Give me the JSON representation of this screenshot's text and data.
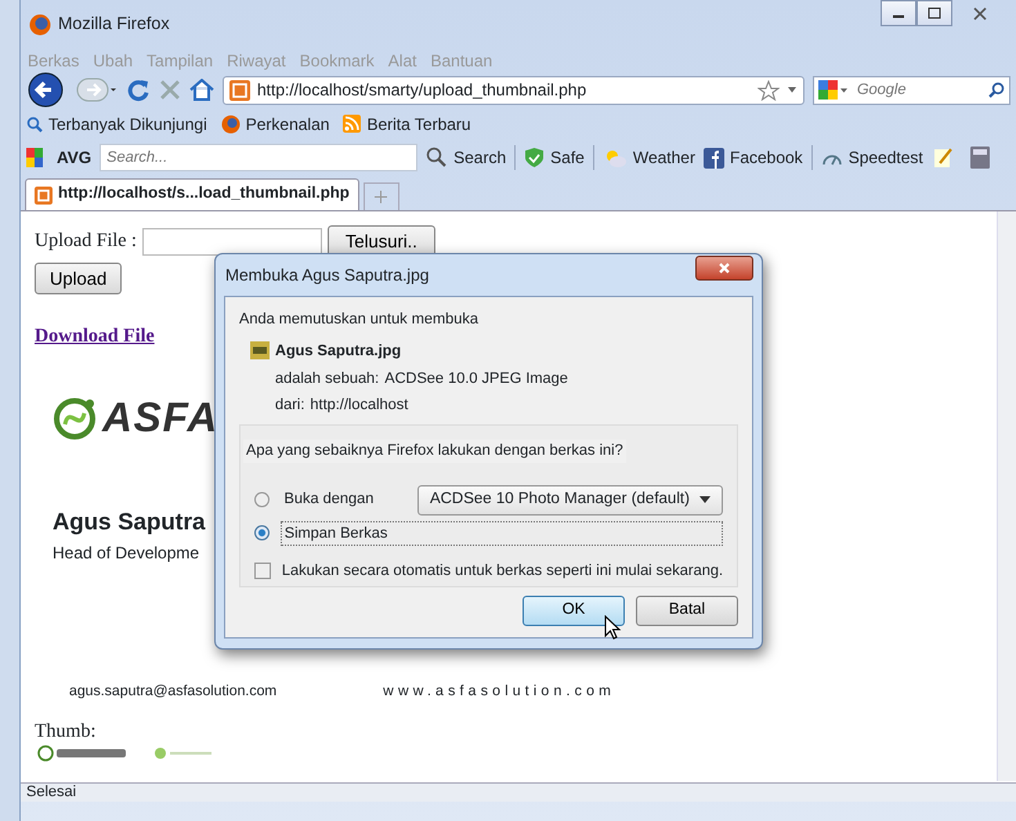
{
  "window": {
    "title": "Mozilla Firefox"
  },
  "menu": [
    "Berkas",
    "Ubah",
    "Tampilan",
    "Riwayat",
    "Bookmark",
    "Alat",
    "Bantuan"
  ],
  "address": {
    "value": "http://localhost/smarty/upload_thumbnail.php"
  },
  "web_search": {
    "placeholder": "Google"
  },
  "bookmarks": [
    "Terbanyak Dikunjungi",
    "Perkenalan",
    "Berita Terbaru"
  ],
  "avg_toolbar": {
    "brand": "AVG",
    "search_placeholder": "Search...",
    "items": [
      "Search",
      "Safe",
      "Weather",
      "Facebook",
      "Speedtest"
    ]
  },
  "tabs": [
    {
      "label": "http://localhost/s...load_thumbnail.php",
      "selected": true
    }
  ],
  "page": {
    "upload_label": "Upload File :",
    "browse_button": "Telusuri..",
    "upload_button": "Upload",
    "download_link": "Download File",
    "card": {
      "logo": "ASFA",
      "name": "Agus Saputra",
      "title": "Head of Developme",
      "email": "agus.saputra@asfasolution.com",
      "website": "www.asfasolution.com"
    },
    "thumb_label": "Thumb:"
  },
  "dialog": {
    "title": "Membuka Agus Saputra.jpg",
    "intro": "Anda memutuskan untuk membuka",
    "file_name": "Agus Saputra.jpg",
    "type_label": "adalah sebuah:",
    "type_value": "ACDSee 10.0 JPEG Image",
    "from_label": "dari:",
    "from_value": "http://localhost",
    "question": "Apa yang sebaiknya Firefox lakukan dengan berkas ini?",
    "options": [
      {
        "label": "Buka dengan",
        "selected": false
      },
      {
        "label": "Simpan Berkas",
        "selected": true
      }
    ],
    "app_select": "ACDSee 10 Photo Manager (default)",
    "auto_checkbox": {
      "label": "Lakukan secara otomatis untuk berkas seperti ini mulai sekarang.",
      "checked": false
    },
    "buttons": [
      "OK",
      "Batal"
    ]
  },
  "status_bar": "Selesai"
}
